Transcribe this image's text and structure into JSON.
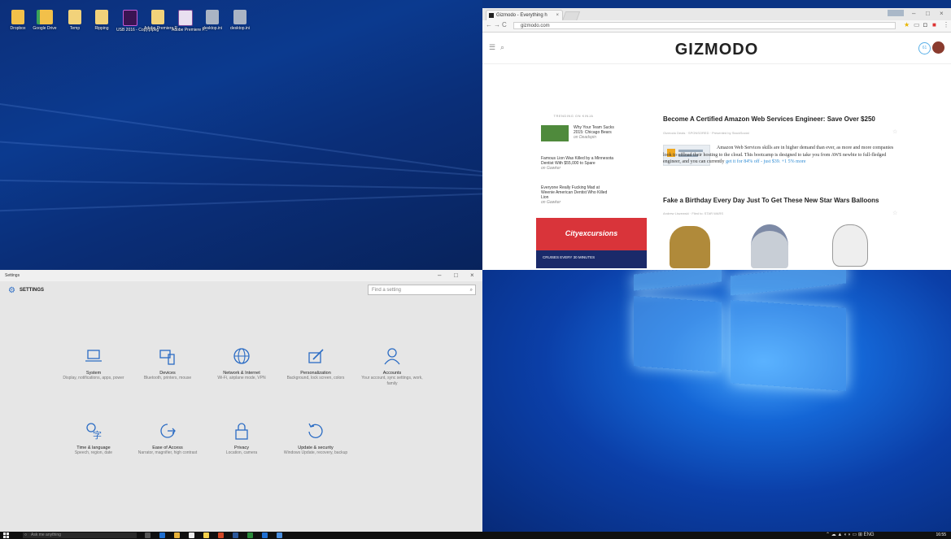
{
  "desktop": {
    "icons": [
      "Dropbox",
      "Google Drive",
      "Temp",
      "Ripping",
      "USB 2016 - Copy.pipeg",
      "Adobe Premiere P...",
      "Adobe Premiere P...",
      "desktop.ini",
      "desktop.ini"
    ]
  },
  "browser": {
    "tab_title": "Gizmodo - Everything h",
    "url": "gizmodo.com",
    "logo": "GIZMODO",
    "avatar_count": "61",
    "trending_title": "TRENDING ON KINJA",
    "trending": [
      {
        "text": "Why Your Team Sucks 2015: Chicago Bears",
        "source": "on Deadspin"
      },
      {
        "text": "Famous Lion Was Killed by a Minnesota Dentist With $55,000 to Spare",
        "source": "on Gawker"
      },
      {
        "text": "Everyone Really Fucking Mad at Weenie American Dentist Who Killed Lion",
        "source": "on Gawker"
      }
    ],
    "ad_title": "Cityexcursions",
    "ad_text": "CRUISES EVERY 30 MINUTES",
    "article1": {
      "title": "Become A Certified Amazon Web Services Engineer: Save Over $250",
      "meta": "Gizmodo Deals · SPONSORED · Presented by StackSocial",
      "body": "Amazon Web Services skills are in higher demand than ever, as more and more companies look to offload their hosting to the cloud. This bootcamp is designed to take you from AWS newbie to full-fledged engineer, and you can currently",
      "link": "get it for 84% off - just $39. +1 5% more"
    },
    "article2": {
      "title": "Fake a Birthday Every Day Just To Get These New Star Wars Balloons",
      "meta": "Andrew Liszewski · Filed to: STAR WARS"
    }
  },
  "settings": {
    "window_title": "Settings",
    "header": "SETTINGS",
    "search_placeholder": "Find a setting",
    "categories": [
      {
        "name": "System",
        "desc": "Display, notifications, apps, power"
      },
      {
        "name": "Devices",
        "desc": "Bluetooth, printers, mouse"
      },
      {
        "name": "Network & Internet",
        "desc": "Wi-Fi, airplane mode, VPN"
      },
      {
        "name": "Personalization",
        "desc": "Background, lock screen, colors"
      },
      {
        "name": "Accounts",
        "desc": "Your account, sync settings, work, family"
      },
      {
        "name": "Time & language",
        "desc": "Speech, region, date"
      },
      {
        "name": "Ease of Access",
        "desc": "Narrator, magnifier, high contrast"
      },
      {
        "name": "Privacy",
        "desc": "Location, camera"
      },
      {
        "name": "Update & security",
        "desc": "Windows Update, recovery, backup"
      }
    ]
  },
  "taskbar": {
    "search_placeholder": "Ask me anything",
    "clock": "16:55"
  }
}
